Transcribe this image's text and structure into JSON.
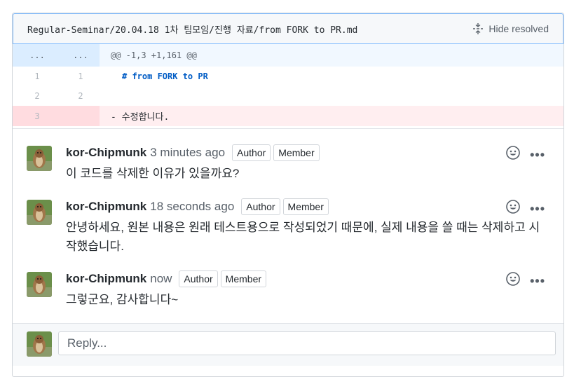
{
  "file": {
    "path": "Regular-Seminar/20.04.18 1차 팀모임/진행 자료/from FORK to PR.md",
    "hide_resolved_label": "Hide resolved",
    "hide_resolved_icon": "fold-icon"
  },
  "diff": {
    "hunk": {
      "left": "...",
      "right": "...",
      "header": "@@ -1,3 +1,161 @@"
    },
    "rows": [
      {
        "type": "context",
        "left": "1",
        "right": "1",
        "code": "# from FORK to PR"
      },
      {
        "type": "context",
        "left": "2",
        "right": "2",
        "code": ""
      },
      {
        "type": "deletion",
        "left": "3",
        "right": "",
        "code": "- 수정합니다."
      }
    ]
  },
  "comments": [
    {
      "author": "kor-Chipmunk",
      "time": "3 minutes ago",
      "badges": [
        "Author",
        "Member"
      ],
      "body": "이 코드를 삭제한 이유가 있을까요?"
    },
    {
      "author": "kor-Chipmunk",
      "time": "18 seconds ago",
      "badges": [
        "Author",
        "Member"
      ],
      "body": "안녕하세요, 원본 내용은 원래 테스트용으로 작성되었기 때문에, 실제 내용을 쓸 때는 삭제하고 시작했습니다."
    },
    {
      "author": "kor-Chipmunk",
      "time": "now",
      "badges": [
        "Author",
        "Member"
      ],
      "body": "그렇군요, 감사합니다~"
    }
  ],
  "reply": {
    "placeholder": "Reply..."
  },
  "colors": {
    "hunk_bg": "#dbedff",
    "deletion_bg": "#ffeef0",
    "header_border": "#79b8ff",
    "md_heading": "#005cc5"
  }
}
